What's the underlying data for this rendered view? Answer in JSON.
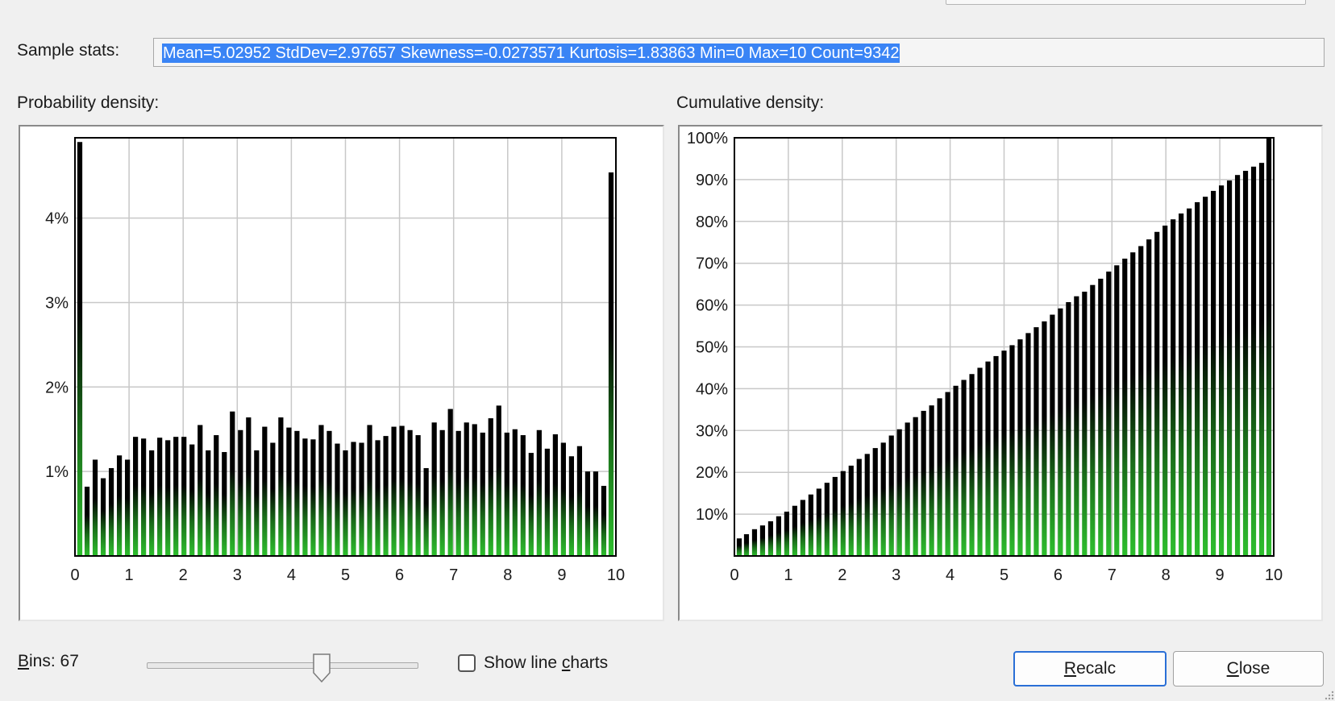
{
  "sample_stats": {
    "label": "Sample stats:",
    "value": "Mean=5.02952  StdDev=2.97657  Skewness=-0.0273571  Kurtosis=1.83863  Min=0  Max=10  Count=9342"
  },
  "pdf_title": "Probability density:",
  "cdf_title": "Cumulative density:",
  "bins": {
    "prefix": "B",
    "rest": "ins:",
    "count": "67",
    "slider_value": 67
  },
  "show_line_charts": {
    "before": "Show line ",
    "accel": "c",
    "after": "harts",
    "checked": false
  },
  "buttons": {
    "recalc": {
      "accel": "R",
      "rest": "ecalc"
    },
    "close": {
      "accel": "C",
      "rest": "lose"
    }
  },
  "colors": {
    "bar_top": "#000000",
    "bar_bottom": "#2ec02e",
    "selection": "#3a84f5",
    "grid": "#c8c8c8",
    "default_button_border": "#2a6fd6"
  },
  "chart_data": [
    {
      "type": "bar",
      "title": "Probability density:",
      "x_range": [
        0,
        10
      ],
      "bin_width": 0.14925,
      "x_ticks": [
        "0",
        "1",
        "2",
        "3",
        "4",
        "5",
        "6",
        "7",
        "8",
        "9",
        "10"
      ],
      "y_ticks": [
        "1%",
        "2%",
        "3%",
        "4%"
      ],
      "y_unit": "%",
      "ylim": [
        0,
        4.95
      ],
      "grid": true,
      "values": [
        4.9,
        0.82,
        1.14,
        0.92,
        1.04,
        1.19,
        1.14,
        1.41,
        1.39,
        1.25,
        1.4,
        1.37,
        1.41,
        1.41,
        1.32,
        1.55,
        1.25,
        1.43,
        1.23,
        1.71,
        1.49,
        1.64,
        1.25,
        1.53,
        1.34,
        1.64,
        1.52,
        1.48,
        1.39,
        1.38,
        1.55,
        1.48,
        1.33,
        1.25,
        1.35,
        1.34,
        1.55,
        1.37,
        1.42,
        1.53,
        1.54,
        1.49,
        1.43,
        1.04,
        1.58,
        1.49,
        1.74,
        1.48,
        1.58,
        1.56,
        1.46,
        1.63,
        1.78,
        1.46,
        1.5,
        1.43,
        1.22,
        1.49,
        1.27,
        1.44,
        1.34,
        1.18,
        1.3,
        1.0,
        1.0,
        0.83,
        4.54
      ]
    },
    {
      "type": "bar",
      "title": "Cumulative density:",
      "x_range": [
        0,
        10
      ],
      "bin_width": 0.14925,
      "x_ticks": [
        "0",
        "1",
        "2",
        "3",
        "4",
        "5",
        "6",
        "7",
        "8",
        "9",
        "10"
      ],
      "y_ticks": [
        "10%",
        "20%",
        "30%",
        "40%",
        "50%",
        "60%",
        "70%",
        "80%",
        "90%",
        "100%"
      ],
      "y_unit": "%",
      "ylim": [
        0,
        100
      ],
      "grid": true,
      "values": [
        4.2,
        5.2,
        6.4,
        7.3,
        8.3,
        9.5,
        10.6,
        12.0,
        13.4,
        14.7,
        16.1,
        17.5,
        18.9,
        20.3,
        21.6,
        23.2,
        24.4,
        25.8,
        27.1,
        28.8,
        30.3,
        31.9,
        33.2,
        34.7,
        36.0,
        37.7,
        39.2,
        40.7,
        42.1,
        43.5,
        45.0,
        46.5,
        47.8,
        49.1,
        50.4,
        51.8,
        53.3,
        54.7,
        56.1,
        57.7,
        59.2,
        60.7,
        62.1,
        63.2,
        64.8,
        66.3,
        68.0,
        69.5,
        71.1,
        72.6,
        74.1,
        75.7,
        77.5,
        79.0,
        80.5,
        81.9,
        83.1,
        84.6,
        85.9,
        87.3,
        88.6,
        89.8,
        91.1,
        92.1,
        93.1,
        94.0,
        100.0
      ]
    }
  ]
}
